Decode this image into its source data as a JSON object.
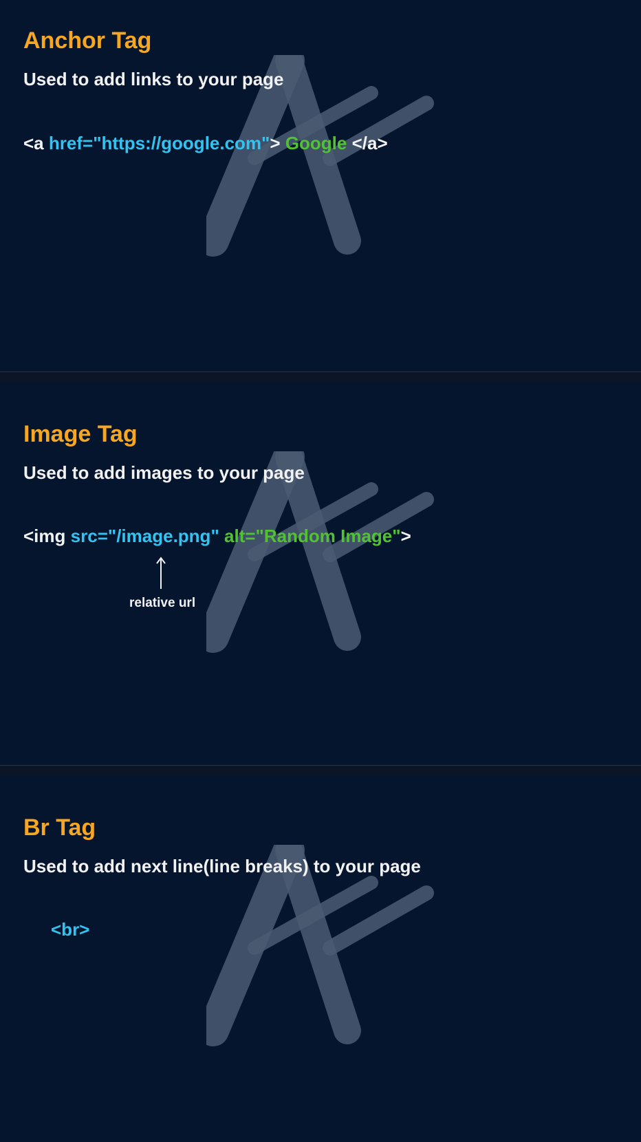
{
  "anchor": {
    "title": "Anchor Tag",
    "subtitle": "Used to add links to your page",
    "code": {
      "open": "<a",
      "attr": "href=\"https://google.com\"",
      "close_open": ">",
      "text": "Google",
      "end": "</a>"
    }
  },
  "image": {
    "title": "Image Tag",
    "subtitle": "Used to add images to your page",
    "code": {
      "open": "<img",
      "src": "src=\"/image.png\"",
      "alt_name": "alt=\"",
      "alt_value": "Random Image",
      "alt_quote": "\"",
      "close": ">"
    },
    "annotation": "relative url"
  },
  "br": {
    "title": "Br Tag",
    "subtitle": "Used to add next line(line breaks) to your page",
    "code": "<br>"
  },
  "colors": {
    "background": "#06152e",
    "title": "#f5a623",
    "attribute": "#33c3f0",
    "value": "#52c234",
    "text": "#f2f2f2"
  }
}
